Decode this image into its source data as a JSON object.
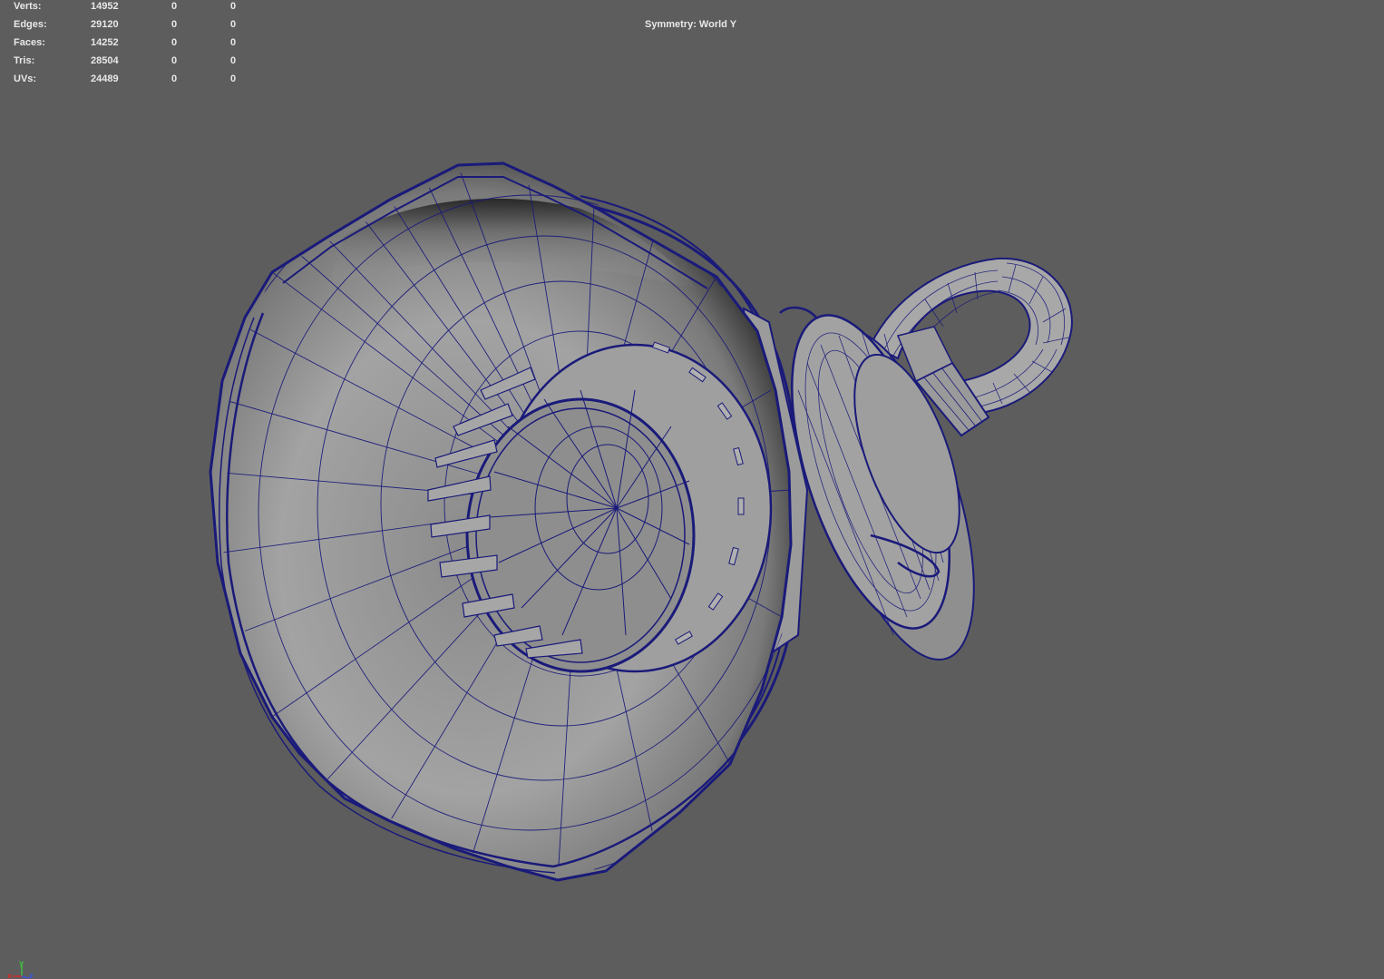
{
  "hud": {
    "rows": [
      {
        "label": "Verts:",
        "total": "14952",
        "selected": "0",
        "selected_tris": "0"
      },
      {
        "label": "Edges:",
        "total": "29120",
        "selected": "0",
        "selected_tris": "0"
      },
      {
        "label": "Faces:",
        "total": "14252",
        "selected": "0",
        "selected_tris": "0"
      },
      {
        "label": "Tris:",
        "total": "28504",
        "selected": "0",
        "selected_tris": "0"
      },
      {
        "label": "UVs:",
        "total": "24489",
        "selected": "0",
        "selected_tris": "0"
      }
    ]
  },
  "symmetry": "Symmetry: World Y",
  "axis": {
    "x": "x",
    "y": "y",
    "z": "z"
  },
  "colors": {
    "background": "#5d5d5d",
    "wire": "#1a1a7a",
    "surface": "#9a9a9a",
    "hud_text": "#e8e8e8",
    "axis_x": "#d22d2d",
    "axis_y": "#3fbf3f",
    "axis_z": "#3a57d6"
  }
}
